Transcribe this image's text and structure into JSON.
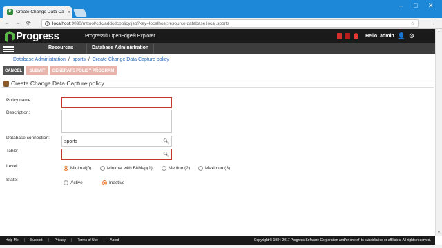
{
  "browser": {
    "tab_title": "Create Change Data Cap",
    "url_prefix": "localhost",
    "url_rest": ":9090/mttool/cdc/addcdcpolicy.jsp?key=localhost:resource.database.local.sports"
  },
  "header": {
    "logo_text": "Progress",
    "product_text": "Progress® OpenEdge® Explorer",
    "greeting": "Hello, admin"
  },
  "nav": {
    "items": [
      {
        "label": "Resources"
      },
      {
        "label": "Database Administration"
      }
    ]
  },
  "breadcrumb": {
    "items": [
      "Database Administration",
      "sports",
      "Create Change Data Capture policy"
    ],
    "separator": "/"
  },
  "toolbar": {
    "cancel": "CANCEL",
    "submit": "SUBMIT",
    "generate": "GENERATE POLICY PROGRAM"
  },
  "panel": {
    "title": "Create Change Data Capture policy"
  },
  "form": {
    "policy_name_label": "Policy name:",
    "policy_name_value": "",
    "description_label": "Description:",
    "description_value": "",
    "db_connection_label": "Database connection:",
    "db_connection_value": "sports",
    "table_label": "Table:",
    "table_value": "",
    "level_label": "Level:",
    "level_options": [
      "Minimal(0)",
      "Minimal with BitMap(1)",
      "Medium(2)",
      "Maximum(3)"
    ],
    "level_selected": "Minimal(0)",
    "state_label": "State:",
    "state_options": [
      "Active",
      "Inactive"
    ],
    "state_selected": "Inactive"
  },
  "footer": {
    "links": [
      "Help Me",
      "Support",
      "Privacy",
      "Terms of Use",
      "About"
    ],
    "copyright": "Copyright © 1984-2017 Progress Software Corporation and/or one of its subsidiaries or affiliates. All rights reserved."
  },
  "colors": {
    "accent_orange": "#e8762c",
    "error_border": "#c0392b",
    "header_bg": "#1a1a1a",
    "link": "#2a6ebb"
  }
}
